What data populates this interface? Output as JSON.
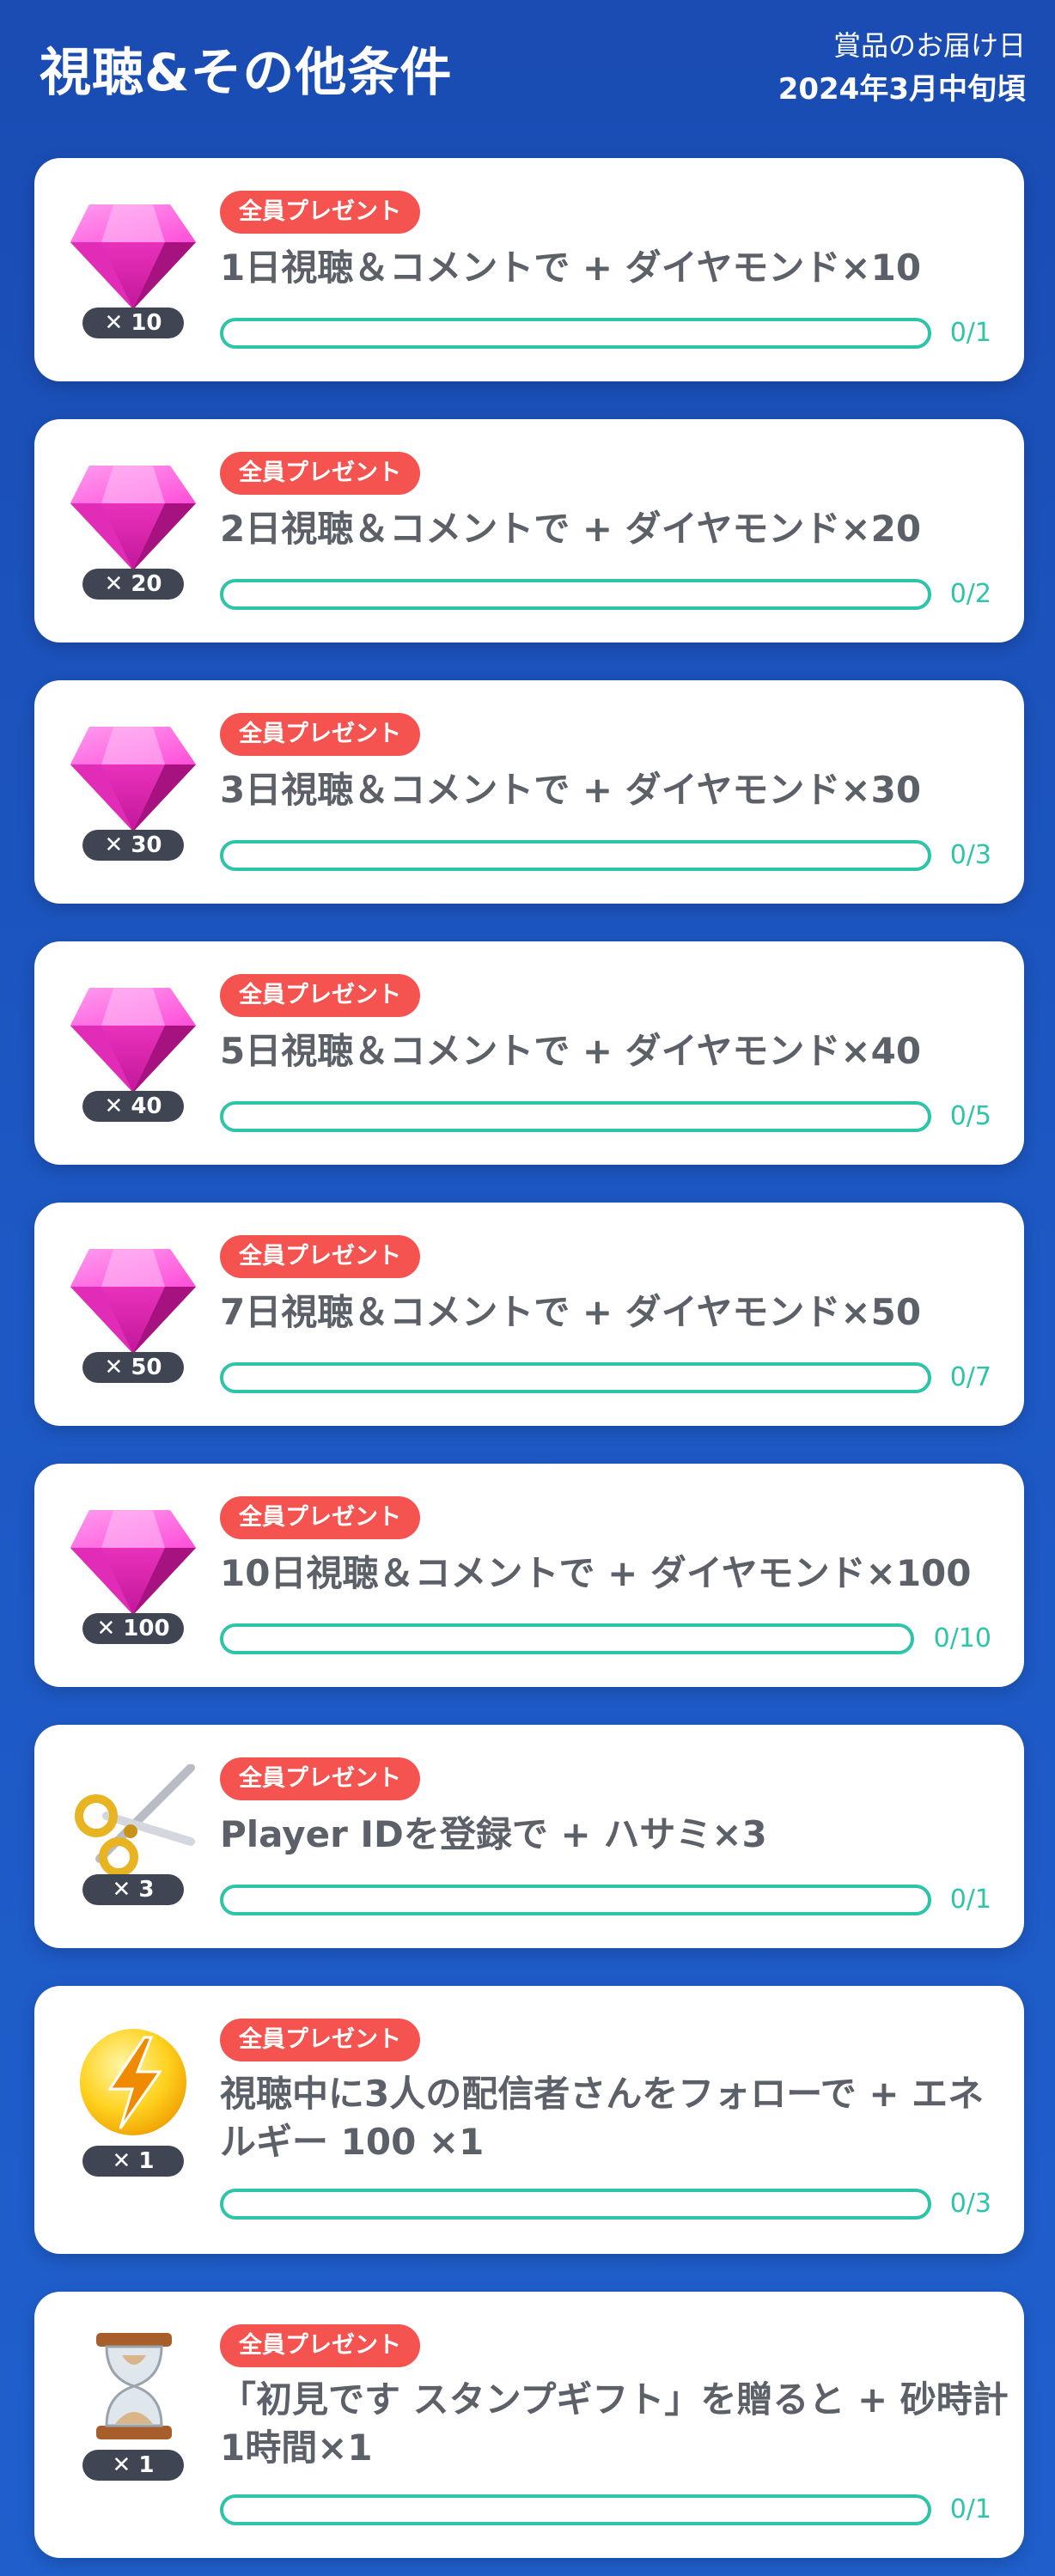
{
  "header": {
    "title": "視聴&その他条件",
    "delivery_label": "賞品のお届け日",
    "delivery_date": "2024年3月中旬頃"
  },
  "colors": {
    "accent": "#2ec4a9",
    "tag": "#f4534f",
    "badge": "#3f4552",
    "background": "#1d58c4"
  },
  "tasks": [
    {
      "tag": "全員プレゼント",
      "text": "1日視聴＆コメントで + ダイヤモンド×10",
      "badge": "✕ 10",
      "progress": "0/1",
      "icon": "diamond-icon",
      "fill": 0
    },
    {
      "tag": "全員プレゼント",
      "text": "2日視聴＆コメントで + ダイヤモンド×20",
      "badge": "✕ 20",
      "progress": "0/2",
      "icon": "diamond-icon",
      "fill": 0
    },
    {
      "tag": "全員プレゼント",
      "text": "3日視聴＆コメントで + ダイヤモンド×30",
      "badge": "✕ 30",
      "progress": "0/3",
      "icon": "diamond-icon",
      "fill": 0
    },
    {
      "tag": "全員プレゼント",
      "text": "5日視聴＆コメントで + ダイヤモンド×40",
      "badge": "✕ 40",
      "progress": "0/5",
      "icon": "diamond-icon",
      "fill": 0
    },
    {
      "tag": "全員プレゼント",
      "text": "7日視聴＆コメントで + ダイヤモンド×50",
      "badge": "✕ 50",
      "progress": "0/7",
      "icon": "diamond-icon",
      "fill": 0
    },
    {
      "tag": "全員プレゼント",
      "text": "10日視聴＆コメントで + ダイヤモンド×100",
      "badge": "✕ 100",
      "progress": "0/10",
      "icon": "diamond-icon",
      "fill": 0
    },
    {
      "tag": "全員プレゼント",
      "text": "Player IDを登録で + ハサミ×3",
      "badge": "✕ 3",
      "progress": "0/1",
      "icon": "scissors-icon",
      "fill": 0
    },
    {
      "tag": "全員プレゼント",
      "text": "視聴中に3人の配信者さんをフォローで + エネルギー 100 ×1",
      "badge": "✕ 1",
      "progress": "0/3",
      "icon": "energy-lightning-icon",
      "fill": 0
    },
    {
      "tag": "全員プレゼント",
      "text": "「初見です スタンプギフト」を贈ると + 砂時計1時間×1",
      "badge": "✕ 1",
      "progress": "0/1",
      "icon": "hourglass-icon",
      "fill": 0
    }
  ]
}
